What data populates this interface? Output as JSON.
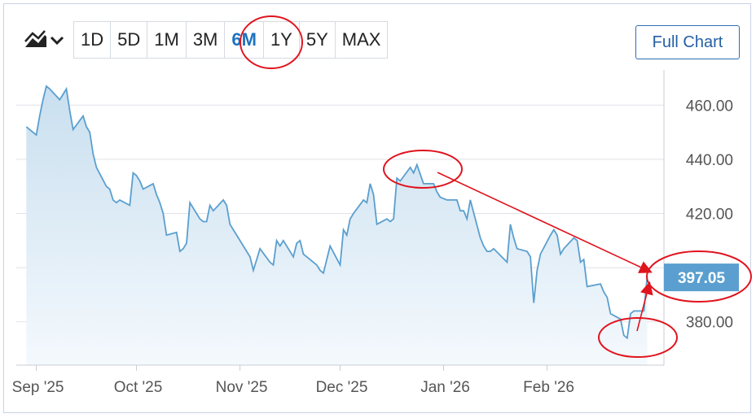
{
  "toolbar": {
    "chart_type_icon": "area-chart-icon",
    "dropdown_icon": "chevron-down-icon",
    "ranges": [
      "1D",
      "5D",
      "1M",
      "3M",
      "6M",
      "1Y",
      "5Y",
      "MAX"
    ],
    "active_range": "6M",
    "full_chart_label": "Full Chart"
  },
  "colors": {
    "line": "#5a9fcf",
    "fill_top": "#c9dfef",
    "fill_bottom": "#f4f9fd",
    "price_label_bg": "#5a9fcf",
    "annotation": "#e0141e",
    "grid": "#dfe2e8"
  },
  "chart_data": {
    "type": "area",
    "x_ticks": [
      "Sep '25",
      "Oct '25",
      "Nov '25",
      "Dec '25",
      "Jan '26",
      "Feb '26"
    ],
    "x_tick_dates": [
      "2025-09-01",
      "2025-10-01",
      "2025-11-01",
      "2025-12-01",
      "2026-01-01",
      "2026-02-01"
    ],
    "y_ticks": [
      "460.00",
      "440.00",
      "420.00",
      "380.00"
    ],
    "y_tick_values": [
      460,
      440,
      420,
      400,
      380
    ],
    "ylim": [
      364,
      473
    ],
    "last_price_label": "397.05",
    "grid": true,
    "series": [
      {
        "points": [
          [
            "2025-08-29",
            452
          ],
          [
            "2025-09-01",
            449
          ],
          [
            "2025-09-02",
            456
          ],
          [
            "2025-09-03",
            462
          ],
          [
            "2025-09-04",
            467
          ],
          [
            "2025-09-05",
            466
          ],
          [
            "2025-09-08",
            462
          ],
          [
            "2025-09-09",
            464
          ],
          [
            "2025-09-10",
            466
          ],
          [
            "2025-09-11",
            458
          ],
          [
            "2025-09-12",
            451
          ],
          [
            "2025-09-15",
            456
          ],
          [
            "2025-09-16",
            452
          ],
          [
            "2025-09-17",
            450
          ],
          [
            "2025-09-18",
            442
          ],
          [
            "2025-09-19",
            437
          ],
          [
            "2025-09-22",
            430
          ],
          [
            "2025-09-23",
            429
          ],
          [
            "2025-09-24",
            425
          ],
          [
            "2025-09-25",
            424
          ],
          [
            "2025-09-26",
            425
          ],
          [
            "2025-09-29",
            423
          ],
          [
            "2025-09-30",
            435
          ],
          [
            "2025-10-01",
            434
          ],
          [
            "2025-10-02",
            432
          ],
          [
            "2025-10-03",
            429
          ],
          [
            "2025-10-06",
            431
          ],
          [
            "2025-10-07",
            427
          ],
          [
            "2025-10-08",
            424
          ],
          [
            "2025-10-09",
            420
          ],
          [
            "2025-10-10",
            412
          ],
          [
            "2025-10-13",
            413
          ],
          [
            "2025-10-14",
            406
          ],
          [
            "2025-10-15",
            407
          ],
          [
            "2025-10-16",
            409
          ],
          [
            "2025-10-17",
            424
          ],
          [
            "2025-10-20",
            418
          ],
          [
            "2025-10-21",
            417
          ],
          [
            "2025-10-22",
            417
          ],
          [
            "2025-10-23",
            423
          ],
          [
            "2025-10-24",
            421
          ],
          [
            "2025-10-27",
            425
          ],
          [
            "2025-10-28",
            423
          ],
          [
            "2025-10-29",
            416
          ],
          [
            "2025-10-30",
            414
          ],
          [
            "2025-10-31",
            412
          ],
          [
            "2025-11-03",
            406
          ],
          [
            "2025-11-04",
            404
          ],
          [
            "2025-11-05",
            399
          ],
          [
            "2025-11-06",
            403
          ],
          [
            "2025-11-07",
            407
          ],
          [
            "2025-11-10",
            402
          ],
          [
            "2025-11-11",
            401
          ],
          [
            "2025-11-12",
            410
          ],
          [
            "2025-11-13",
            408
          ],
          [
            "2025-11-14",
            410
          ],
          [
            "2025-11-17",
            404
          ],
          [
            "2025-11-18",
            409
          ],
          [
            "2025-11-19",
            410
          ],
          [
            "2025-11-20",
            405
          ],
          [
            "2025-11-21",
            404
          ],
          [
            "2025-11-24",
            401
          ],
          [
            "2025-11-25",
            399
          ],
          [
            "2025-11-26",
            398
          ],
          [
            "2025-11-28",
            408
          ],
          [
            "2025-12-01",
            401
          ],
          [
            "2025-12-02",
            414
          ],
          [
            "2025-12-03",
            412
          ],
          [
            "2025-12-04",
            418
          ],
          [
            "2025-12-05",
            420
          ],
          [
            "2025-12-08",
            425
          ],
          [
            "2025-12-09",
            424
          ],
          [
            "2025-12-10",
            431
          ],
          [
            "2025-12-11",
            427
          ],
          [
            "2025-12-12",
            416
          ],
          [
            "2025-12-15",
            418
          ],
          [
            "2025-12-16",
            417
          ],
          [
            "2025-12-17",
            418
          ],
          [
            "2025-12-18",
            433
          ],
          [
            "2025-12-19",
            432
          ],
          [
            "2025-12-22",
            437
          ],
          [
            "2025-12-23",
            435
          ],
          [
            "2025-12-24",
            438
          ],
          [
            "2025-12-26",
            431
          ],
          [
            "2025-12-29",
            431
          ],
          [
            "2025-12-30",
            428
          ],
          [
            "2025-12-31",
            426
          ],
          [
            "2026-01-02",
            425
          ],
          [
            "2026-01-05",
            425
          ],
          [
            "2026-01-06",
            421
          ],
          [
            "2026-01-07",
            421
          ],
          [
            "2026-01-08",
            418
          ],
          [
            "2026-01-09",
            425
          ],
          [
            "2026-01-12",
            411
          ],
          [
            "2026-01-13",
            408
          ],
          [
            "2026-01-14",
            406
          ],
          [
            "2026-01-15",
            406
          ],
          [
            "2026-01-16",
            407
          ],
          [
            "2026-01-20",
            402
          ],
          [
            "2026-01-21",
            416
          ],
          [
            "2026-01-22",
            411
          ],
          [
            "2026-01-23",
            407
          ],
          [
            "2026-01-26",
            406
          ],
          [
            "2026-01-27",
            404
          ],
          [
            "2026-01-28",
            387
          ],
          [
            "2026-01-29",
            399
          ],
          [
            "2026-01-30",
            405
          ],
          [
            "2026-02-02",
            412
          ],
          [
            "2026-02-03",
            414
          ],
          [
            "2026-02-04",
            412
          ],
          [
            "2026-02-05",
            405
          ],
          [
            "2026-02-06",
            407
          ],
          [
            "2026-02-09",
            411
          ],
          [
            "2026-02-10",
            410
          ],
          [
            "2026-02-11",
            402
          ],
          [
            "2026-02-12",
            403
          ],
          [
            "2026-02-13",
            393
          ],
          [
            "2026-02-17",
            394
          ],
          [
            "2026-02-18",
            391
          ],
          [
            "2026-02-19",
            389
          ],
          [
            "2026-02-20",
            383
          ],
          [
            "2026-02-23",
            381
          ],
          [
            "2026-02-24",
            375
          ],
          [
            "2026-02-25",
            374
          ],
          [
            "2026-02-26",
            383
          ],
          [
            "2026-02-27",
            384
          ],
          [
            "2026-03-02",
            384
          ],
          [
            "2026-03-03",
            397
          ]
        ]
      }
    ]
  }
}
